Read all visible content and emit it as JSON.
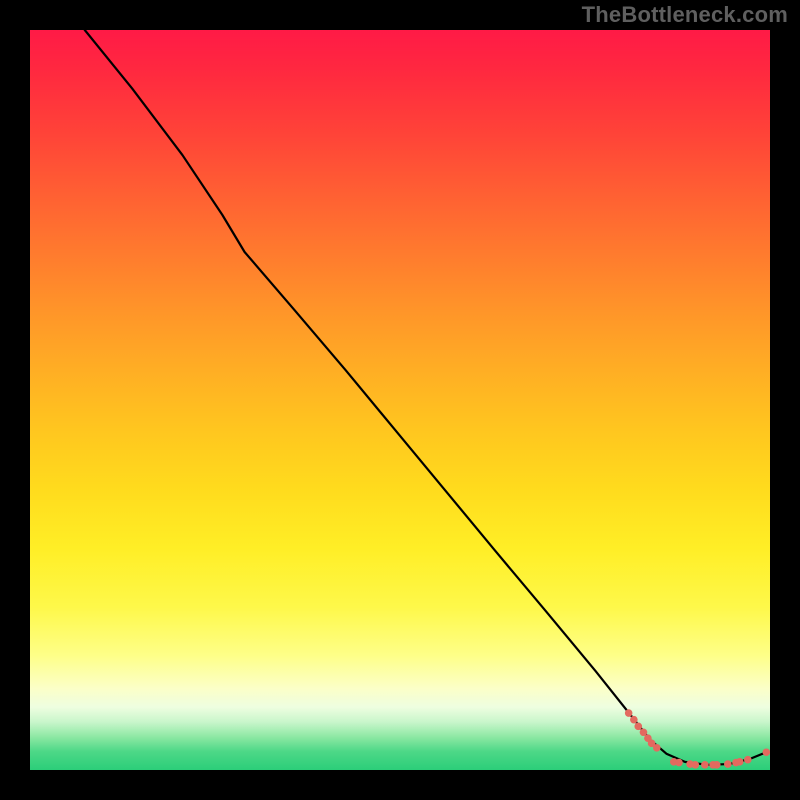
{
  "watermark": "TheBottleneck.com",
  "chart_data": {
    "type": "line",
    "title": "",
    "xlabel": "",
    "ylabel": "",
    "xlim": [
      0,
      100
    ],
    "ylim": [
      0,
      100
    ],
    "gradient_stops": [
      {
        "pct": 0,
        "color": "#ff1a46"
      },
      {
        "pct": 6,
        "color": "#ff2a3f"
      },
      {
        "pct": 14,
        "color": "#ff4338"
      },
      {
        "pct": 22,
        "color": "#ff5f33"
      },
      {
        "pct": 30,
        "color": "#ff7a2e"
      },
      {
        "pct": 38,
        "color": "#ff9529"
      },
      {
        "pct": 46,
        "color": "#ffae24"
      },
      {
        "pct": 54,
        "color": "#ffc61f"
      },
      {
        "pct": 62,
        "color": "#ffdb1d"
      },
      {
        "pct": 70,
        "color": "#ffee26"
      },
      {
        "pct": 78,
        "color": "#fef84a"
      },
      {
        "pct": 84.5,
        "color": "#feff88"
      },
      {
        "pct": 89,
        "color": "#fbffc8"
      },
      {
        "pct": 91.5,
        "color": "#eefee0"
      },
      {
        "pct": 93.5,
        "color": "#c9f6cb"
      },
      {
        "pct": 95.5,
        "color": "#8ee8a4"
      },
      {
        "pct": 97.5,
        "color": "#4dd887"
      },
      {
        "pct": 100,
        "color": "#2bce79"
      }
    ],
    "series": [
      {
        "name": "bottleneck-curve",
        "color": "#000000",
        "points": [
          {
            "x": 7.4,
            "y": 100.0
          },
          {
            "x": 13.8,
            "y": 92.1
          },
          {
            "x": 20.6,
            "y": 83.1
          },
          {
            "x": 26.0,
            "y": 75.0
          },
          {
            "x": 29.0,
            "y": 70.0
          },
          {
            "x": 35.7,
            "y": 62.2
          },
          {
            "x": 42.6,
            "y": 54.1
          },
          {
            "x": 49.3,
            "y": 46.0
          },
          {
            "x": 56.1,
            "y": 37.8
          },
          {
            "x": 62.8,
            "y": 29.7
          },
          {
            "x": 69.6,
            "y": 21.6
          },
          {
            "x": 76.4,
            "y": 13.4
          },
          {
            "x": 81.9,
            "y": 6.5
          },
          {
            "x": 83.8,
            "y": 4.1
          },
          {
            "x": 86.0,
            "y": 2.2
          },
          {
            "x": 88.5,
            "y": 1.1
          },
          {
            "x": 91.5,
            "y": 0.7
          },
          {
            "x": 94.5,
            "y": 0.8
          },
          {
            "x": 97.3,
            "y": 1.5
          },
          {
            "x": 99.5,
            "y": 2.4
          }
        ]
      }
    ],
    "scatter": {
      "name": "highlight-points",
      "color": "#e36a5f",
      "radius": 3.8,
      "points": [
        {
          "x": 80.9,
          "y": 7.7
        },
        {
          "x": 81.6,
          "y": 6.8
        },
        {
          "x": 82.2,
          "y": 5.9
        },
        {
          "x": 82.9,
          "y": 5.1
        },
        {
          "x": 83.5,
          "y": 4.3
        },
        {
          "x": 84.0,
          "y": 3.6
        },
        {
          "x": 84.7,
          "y": 3.0
        },
        {
          "x": 87.0,
          "y": 1.1
        },
        {
          "x": 87.7,
          "y": 1.0
        },
        {
          "x": 89.2,
          "y": 0.8
        },
        {
          "x": 89.9,
          "y": 0.7
        },
        {
          "x": 91.2,
          "y": 0.7
        },
        {
          "x": 92.3,
          "y": 0.7
        },
        {
          "x": 92.8,
          "y": 0.7
        },
        {
          "x": 94.3,
          "y": 0.8
        },
        {
          "x": 95.4,
          "y": 1.0
        },
        {
          "x": 95.9,
          "y": 1.1
        },
        {
          "x": 97.0,
          "y": 1.4
        },
        {
          "x": 99.5,
          "y": 2.4
        }
      ]
    }
  }
}
